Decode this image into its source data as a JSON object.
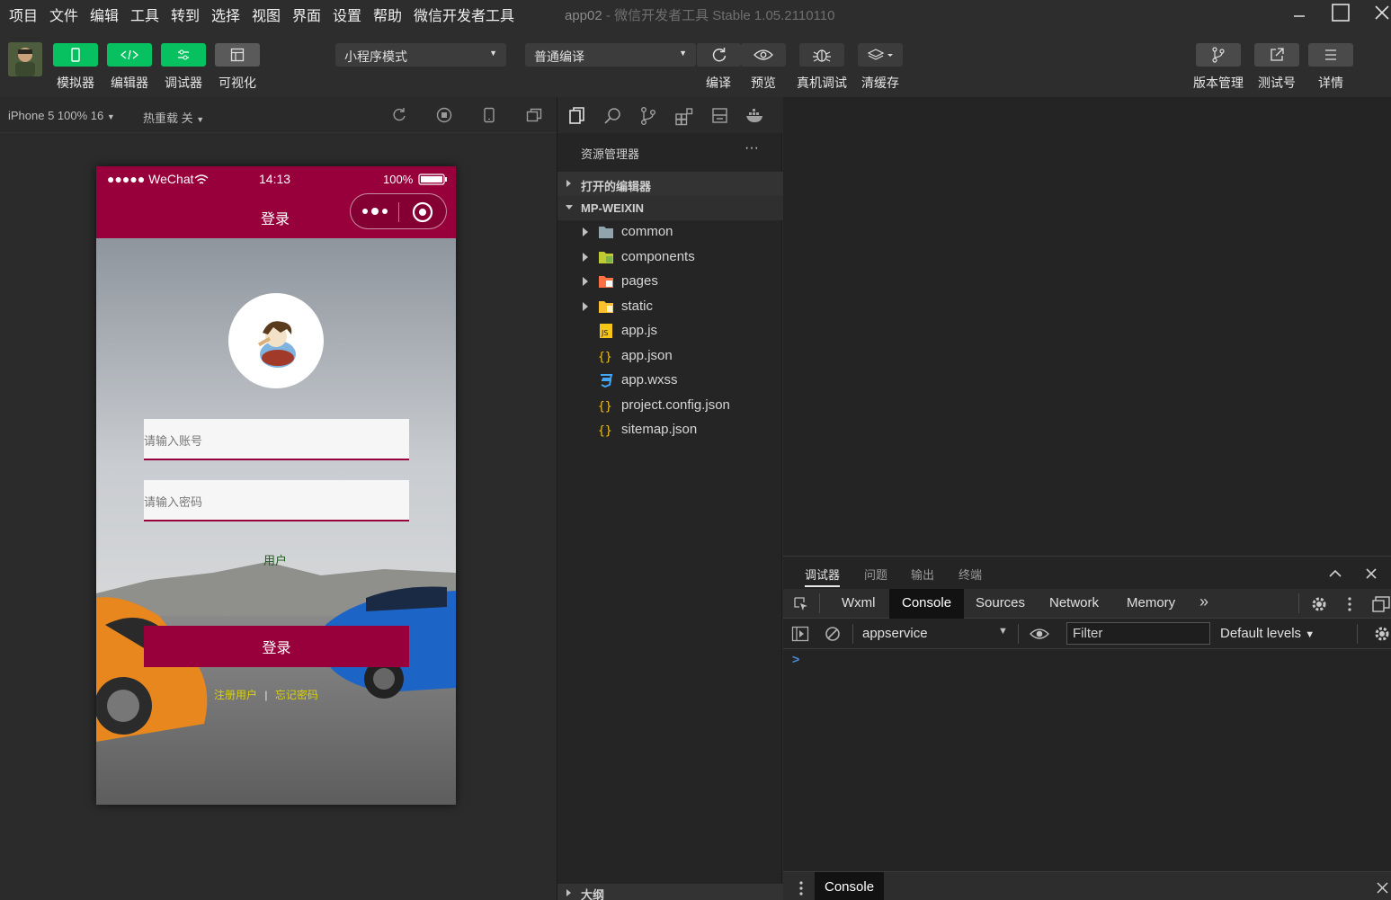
{
  "menu": [
    "项目",
    "文件",
    "编辑",
    "工具",
    "转到",
    "选择",
    "视图",
    "界面",
    "设置",
    "帮助",
    "微信开发者工具"
  ],
  "window": {
    "title": "app02",
    "subtitle": "微信开发者工具 Stable 1.05.2110110"
  },
  "toolbar": {
    "simulator": "模拟器",
    "editor": "编辑器",
    "debugger": "调试器",
    "visual": "可视化",
    "mode_select": "小程序模式",
    "compile_select": "普通编译",
    "compile": "编译",
    "preview": "预览",
    "remote_debug": "真机调试",
    "clear_cache": "清缓存",
    "version": "版本管理",
    "test_account": "测试号",
    "details": "详情"
  },
  "simulator": {
    "device": "iPhone 5 100% 16",
    "hot_reload": "热重载 关"
  },
  "phone": {
    "carrier": "●●●●● WeChat",
    "time": "14:13",
    "battery": "100%",
    "page_title": "登录",
    "account_placeholder": "请输入账号",
    "password_placeholder": "请输入密码",
    "user_label": "用户",
    "login_button": "登录",
    "register_link": "注册用户",
    "separator": "|",
    "forgot_link": "忘记密码"
  },
  "explorer": {
    "title": "资源管理器",
    "more": "···",
    "open_editors": "打开的编辑器",
    "project": "MP-WEIXIN",
    "outline": "大纲",
    "items": [
      {
        "name": "common",
        "type": "folder",
        "icon": "folder-icon",
        "color": "#90a4ae"
      },
      {
        "name": "components",
        "type": "folder",
        "icon": "components-folder-icon",
        "color": "#c0ca33"
      },
      {
        "name": "pages",
        "type": "folder",
        "icon": "pages-folder-icon",
        "color": "#ff7043"
      },
      {
        "name": "static",
        "type": "folder",
        "icon": "static-folder-icon",
        "color": "#fbc02d"
      },
      {
        "name": "app.js",
        "type": "file",
        "icon": "js-file-icon",
        "color": "#f5c518"
      },
      {
        "name": "app.json",
        "type": "file",
        "icon": "json-file-icon",
        "color": "#f5c518"
      },
      {
        "name": "app.wxss",
        "type": "file",
        "icon": "css-file-icon",
        "color": "#42a5f5"
      },
      {
        "name": "project.config.json",
        "type": "file",
        "icon": "json-file-icon",
        "color": "#f5c518"
      },
      {
        "name": "sitemap.json",
        "type": "file",
        "icon": "json-file-icon",
        "color": "#f5c518"
      }
    ]
  },
  "devtools": {
    "tabs": [
      "调试器",
      "问题",
      "输出",
      "终端"
    ],
    "subtabs": [
      "Wxml",
      "Console",
      "Sources",
      "Network",
      "Memory"
    ],
    "more_tabs": "»",
    "context": "appservice",
    "filter_placeholder": "Filter",
    "levels": "Default levels",
    "prompt": ">",
    "drawer_tab": "Console"
  },
  "colors": {
    "brand_green": "#07c160",
    "theme_red": "#97003a"
  }
}
